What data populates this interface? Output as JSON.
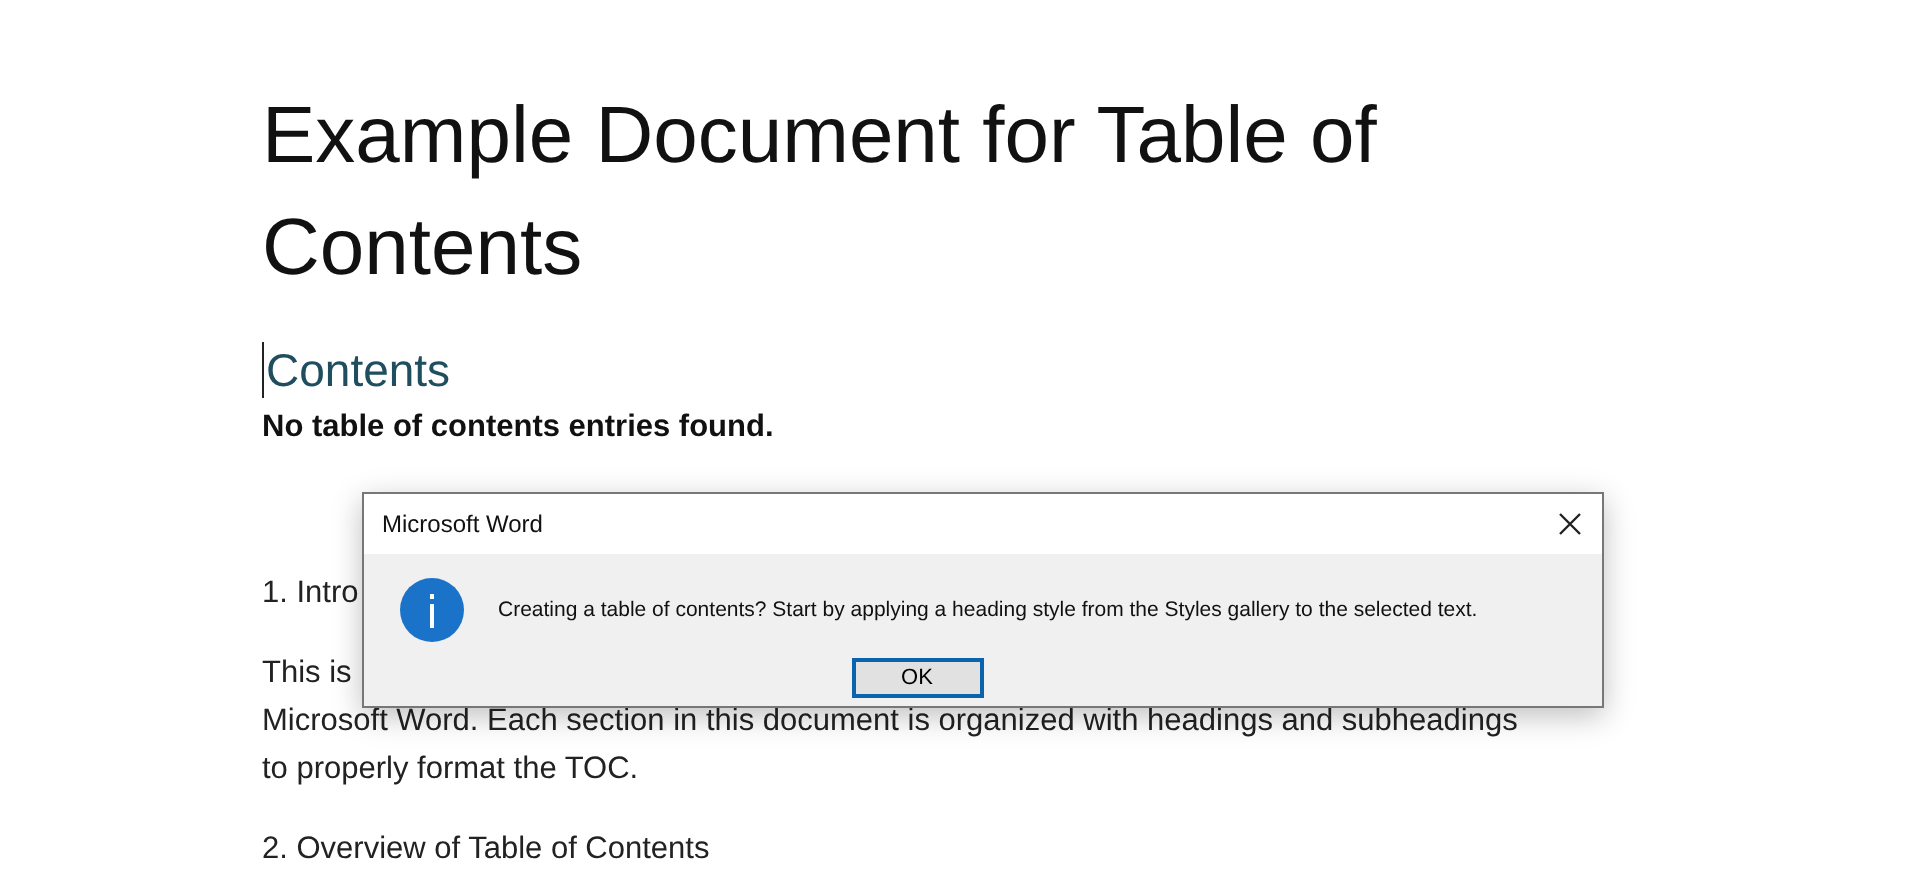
{
  "document": {
    "title_lines": [
      "Example Document for Table of",
      "Contents"
    ],
    "contents_heading": "Contents",
    "toc_message": "No table of contents entries found.",
    "paragraphs": [
      [
        "1. Intro"
      ],
      [
        "This is",
        "Microsoft Word. Each section in this document is organized with headings and subheadings",
        "to properly format the TOC."
      ],
      [
        "2. Overview of Table of Contents"
      ]
    ]
  },
  "dialog": {
    "title": "Microsoft Word",
    "message": "Creating a table of contents? Start by applying a heading style from the Styles gallery to the selected text.",
    "buttons": [
      {
        "label": "OK",
        "selected": true
      }
    ]
  }
}
